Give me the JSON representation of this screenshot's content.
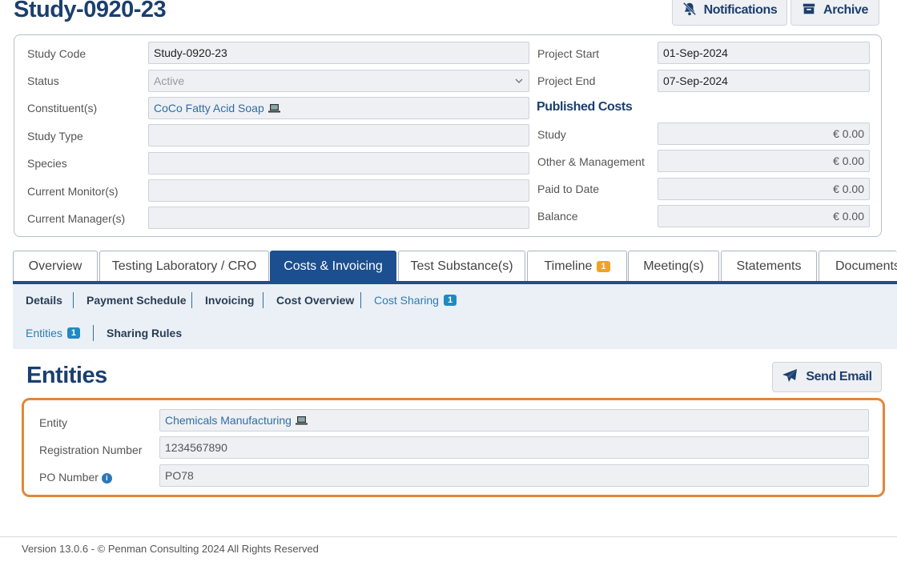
{
  "page": {
    "title": "Study-0920-23"
  },
  "toolbar": {
    "notifications_label": "Notifications",
    "archive_label": "Archive"
  },
  "study": {
    "labels": {
      "code": "Study Code",
      "status": "Status",
      "constituents": "Constituent(s)",
      "type": "Study Type",
      "species": "Species",
      "monitor": "Current Monitor(s)",
      "manager": "Current Manager(s)",
      "start": "Project Start",
      "end": "Project End"
    },
    "values": {
      "code": "Study-0920-23",
      "status": "Active",
      "constituents": "CoCo Fatty Acid Soap",
      "type": "",
      "species": "",
      "monitor": "",
      "manager": "",
      "start": "01-Sep-2024",
      "end": "07-Sep-2024"
    }
  },
  "published_costs": {
    "title": "Published Costs",
    "labels": {
      "study": "Study",
      "other": "Other & Management",
      "paid": "Paid to Date",
      "balance": "Balance"
    },
    "values": {
      "study": "€ 0.00",
      "other": "€ 0.00",
      "paid": "€ 0.00",
      "balance": "€ 0.00"
    }
  },
  "tabs": [
    {
      "label": "Overview"
    },
    {
      "label": "Testing Laboratory / CRO"
    },
    {
      "label": "Costs & Invoicing"
    },
    {
      "label": "Test Substance(s)"
    },
    {
      "label": "Timeline",
      "badge": "1"
    },
    {
      "label": "Meeting(s)"
    },
    {
      "label": "Statements"
    },
    {
      "label": "Documents"
    }
  ],
  "subnav": {
    "row1": [
      {
        "label": "Details"
      },
      {
        "label": "Payment Schedule"
      },
      {
        "label": "Invoicing"
      },
      {
        "label": "Cost Overview"
      },
      {
        "label": "Cost Sharing",
        "badge": "1"
      }
    ],
    "row2": [
      {
        "label": "Entities",
        "badge": "1"
      },
      {
        "label": "Sharing Rules"
      }
    ]
  },
  "entities": {
    "title": "Entities",
    "send_email_label": "Send Email",
    "labels": {
      "entity": "Entity",
      "registration": "Registration Number",
      "po": "PO Number"
    },
    "values": {
      "entity": "Chemicals Manufacturing",
      "registration": "1234567890",
      "po": "PO78"
    }
  },
  "footer": {
    "text": "Version 13.0.6 - © Penman Consulting 2024 All Rights Reserved"
  },
  "colors": {
    "primary": "#1b3f6e",
    "tab_active": "#1b4f8f",
    "highlight": "#e0883a",
    "badge_orange": "#f0a41e",
    "badge_blue": "#1f8ac0"
  }
}
